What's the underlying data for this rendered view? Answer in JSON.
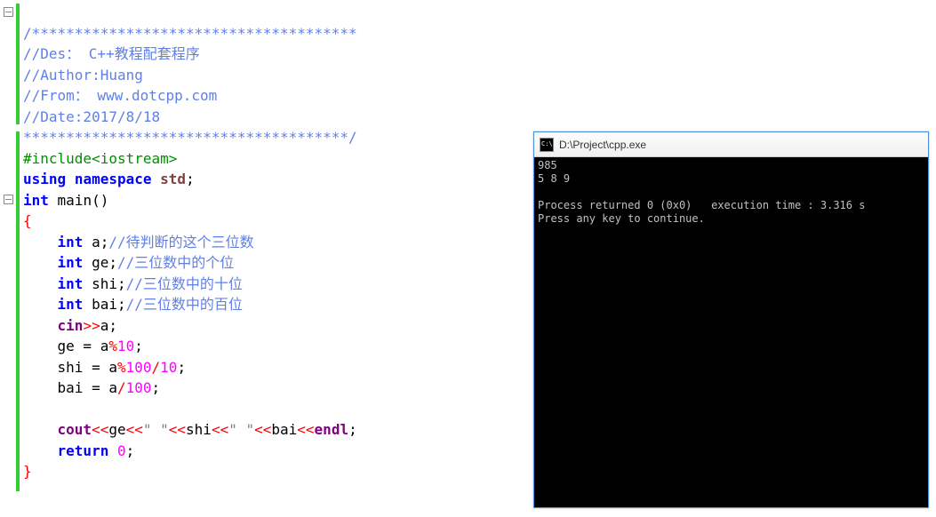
{
  "editor": {
    "comment_block": {
      "line1": "/**************************************",
      "line2": "//Des： C++教程配套程序",
      "line3": "//Author:Huang",
      "line4": "//From： www.dotcpp.com",
      "line5": "//Date:2017/8/18",
      "line6": "**************************************/"
    },
    "include": {
      "directive": "#include",
      "target": "<iostream>"
    },
    "using_line": {
      "kw_using": "using",
      "kw_namespace": "namespace",
      "std": "std",
      "semi": ";"
    },
    "main_sig": {
      "kw_int": "int",
      "name": "main",
      "parens": "()"
    },
    "brace_open": "{",
    "decl_a": {
      "kw": "int",
      "name": "a",
      "semi": ";",
      "cmt": "//待判断的这个三位数"
    },
    "decl_ge": {
      "kw": "int",
      "name": "ge",
      "semi": ";",
      "cmt": "//三位数中的个位"
    },
    "decl_shi": {
      "kw": "int",
      "name": "shi",
      "semi": ";",
      "cmt": "//三位数中的十位"
    },
    "decl_bai": {
      "kw": "int",
      "name": "bai",
      "semi": ";",
      "cmt": "//三位数中的百位"
    },
    "cin_line": {
      "cin": "cin",
      "op": ">>",
      "var": "a",
      "semi": ";"
    },
    "assign_ge": {
      "lhs": "ge",
      "eq": " = ",
      "rhs_var": "a",
      "op": "%",
      "rhs_num": "10",
      "semi": ";"
    },
    "assign_shi": {
      "lhs": "shi",
      "eq": " = ",
      "v1": "a",
      "op1": "%",
      "n1": "100",
      "op2": "/",
      "n2": "10",
      "semi": ";"
    },
    "assign_bai": {
      "lhs": "bai",
      "eq": " = ",
      "v1": "a",
      "op": "/",
      "n1": "100",
      "semi": ";"
    },
    "cout_line": {
      "cout": "cout",
      "op": "<<",
      "v1": "ge",
      "s1": "\" \"",
      "v2": "shi",
      "s2": "\" \"",
      "v3": "bai",
      "endl": "endl",
      "semi": ";"
    },
    "return_line": {
      "kw": "return",
      "val": "0",
      "semi": ";"
    },
    "brace_close": "}"
  },
  "console": {
    "title": "D:\\Project\\cpp.exe",
    "output": "985\n5 8 9\n\nProcess returned 0 (0x0)   execution time : 3.316 s\nPress any key to continue.\n"
  }
}
